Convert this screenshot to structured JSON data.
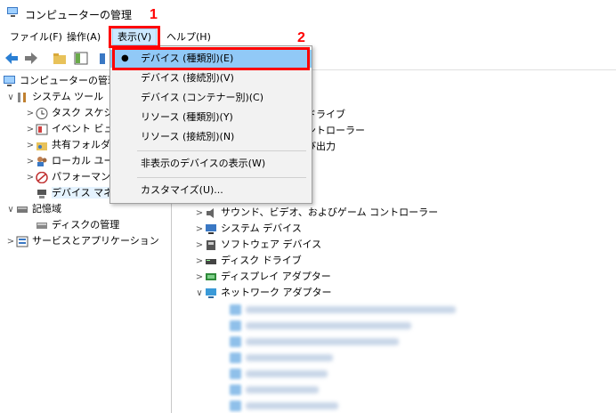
{
  "window": {
    "title": "コンピューターの管理"
  },
  "menubar": {
    "items": [
      "ファイル(F)",
      "操作(A)",
      "表示(V)",
      "ヘルプ(H)"
    ]
  },
  "dropdown": {
    "items": [
      {
        "label": "デバイス (種類別)(E)",
        "selected": true
      },
      {
        "label": "デバイス (接続別)(V)"
      },
      {
        "label": "デバイス (コンテナー別)(C)"
      },
      {
        "label": "リソース (種類別)(Y)"
      },
      {
        "label": "リソース (接続別)(N)"
      },
      {
        "label": "非表示のデバイスの表示(W)"
      },
      {
        "label": "カスタマイズ(U)..."
      }
    ]
  },
  "annotations": {
    "step1": "1",
    "step2": "2"
  },
  "left_tree": [
    {
      "label": "コンピューターの管理",
      "level": 0,
      "chev": ""
    },
    {
      "label": "システム ツール",
      "level": 1,
      "chev": "∨"
    },
    {
      "label": "タスク スケジ",
      "level": 2,
      "chev": ">"
    },
    {
      "label": "イベント ビュー",
      "level": 2,
      "chev": ">"
    },
    {
      "label": "共有フォルダ",
      "level": 2,
      "chev": ">"
    },
    {
      "label": "ローカル ユー",
      "level": 2,
      "chev": ">"
    },
    {
      "label": "パフォーマンス",
      "level": 2,
      "chev": ">"
    },
    {
      "label": "デバイス マネ",
      "level": 2,
      "chev": "",
      "selected": true
    },
    {
      "label": "記憶域",
      "level": 1,
      "chev": "∨"
    },
    {
      "label": "ディスクの管理",
      "level": 2,
      "chev": ""
    },
    {
      "label": "サービスとアプリケーション",
      "level": 1,
      "chev": ">"
    }
  ],
  "right_partial": [
    "ドライブ",
    "ントローラー",
    "び出力"
  ],
  "right_tree": [
    {
      "label": "サウンド、ビデオ、およびゲーム コントローラー",
      "chev": ">"
    },
    {
      "label": "システム デバイス",
      "chev": ">"
    },
    {
      "label": "ソフトウェア デバイス",
      "chev": ">"
    },
    {
      "label": "ディスク ドライブ",
      "chev": ">"
    },
    {
      "label": "ディスプレイ アダプター",
      "chev": ">"
    },
    {
      "label": "ネットワーク アダプター",
      "chev": "∨"
    }
  ],
  "colors": {
    "highlight": "#91c9f7",
    "annotation": "#ff0000"
  }
}
